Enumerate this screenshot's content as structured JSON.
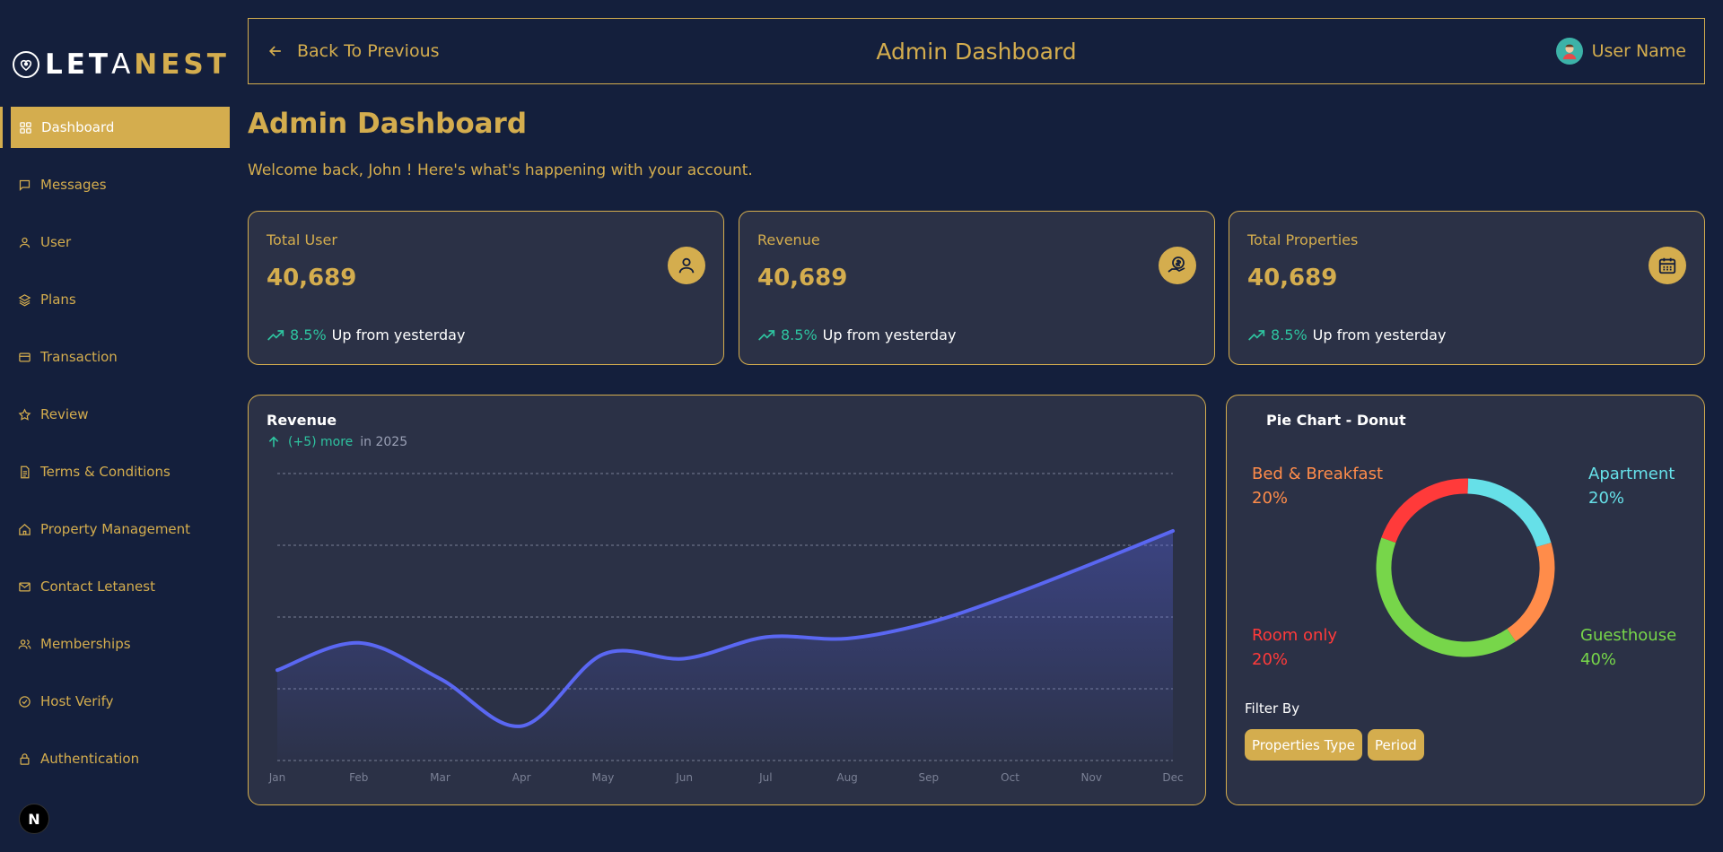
{
  "brand": {
    "name_prefix": "LET",
    "name_a": "A",
    "name_suffix": "NEST"
  },
  "sidebar": {
    "items": [
      {
        "label": "Dashboard",
        "icon": "grid-icon",
        "active": true
      },
      {
        "label": "Messages",
        "icon": "message-icon"
      },
      {
        "label": "User",
        "icon": "user-icon"
      },
      {
        "label": "Plans",
        "icon": "layers-icon"
      },
      {
        "label": "Transaction",
        "icon": "card-icon"
      },
      {
        "label": "Review",
        "icon": "star-icon"
      },
      {
        "label": "Terms & Conditions",
        "icon": "document-icon"
      },
      {
        "label": "Property Management",
        "icon": "home-icon"
      },
      {
        "label": "Contact Letanest",
        "icon": "mail-icon"
      },
      {
        "label": "Memberships",
        "icon": "users-icon"
      },
      {
        "label": "Host Verify",
        "icon": "check-circle-icon"
      },
      {
        "label": "Authentication",
        "icon": "lock-icon"
      }
    ],
    "badge": "N"
  },
  "topbar": {
    "back_label": "Back To Previous",
    "title": "Admin Dashboard",
    "user_name": "User Name"
  },
  "main": {
    "title": "Admin Dashboard",
    "welcome": "Welcome back, John ! Here's what's happening with your account."
  },
  "stats": [
    {
      "label": "Total User",
      "value": "40,689",
      "change": "8.5%",
      "change_text": "Up from yesterday",
      "icon": "user-icon"
    },
    {
      "label": "Revenue",
      "value": "40,689",
      "change": "8.5%",
      "change_text": "Up from yesterday",
      "icon": "money-hand-icon"
    },
    {
      "label": "Total Properties",
      "value": "40,689",
      "change": "8.5%",
      "change_text": "Up from yesterday",
      "icon": "calendar-icon"
    }
  ],
  "revenue_panel": {
    "title": "Revenue",
    "more": "(+5) more",
    "period": "in 2025"
  },
  "pie_panel": {
    "title": "Pie Chart - Donut",
    "filter_label": "Filter By",
    "filters": [
      "Properties Type",
      "Period"
    ]
  },
  "colors": {
    "accent": "#d4ad4e",
    "background": "#141f3c",
    "card": "#2b3146",
    "positive": "#2ec4a0",
    "line": "#5a67f2"
  },
  "chart_data": [
    {
      "type": "area",
      "title": "Revenue",
      "categories": [
        "Jan",
        "Feb",
        "Mar",
        "Apr",
        "May",
        "Jun",
        "Jul",
        "Aug",
        "Sep",
        "Oct",
        "Nov",
        "Dec"
      ],
      "series": [
        {
          "values": [
            0.63,
            0.82,
            0.57,
            0.24,
            0.74,
            0.71,
            0.86,
            0.85,
            0.96,
            1.15,
            1.37,
            1.6
          ]
        }
      ],
      "ylim": [
        0,
        2
      ],
      "grid": true,
      "color": "#5a67f2"
    },
    {
      "type": "pie",
      "title": "Pie Chart - Donut",
      "slices": [
        {
          "name": "Apartment",
          "value": 20,
          "label": "20%",
          "color": "#66e0e8"
        },
        {
          "name": "Bed & Breakfast",
          "value": 20,
          "label": "20%",
          "color": "#ff8c4a"
        },
        {
          "name": "Guesthouse",
          "value": 40,
          "label": "40%",
          "color": "#77d64a"
        },
        {
          "name": "Room only",
          "value": 20,
          "label": "20%",
          "color": "#ff3a3a"
        }
      ]
    }
  ]
}
